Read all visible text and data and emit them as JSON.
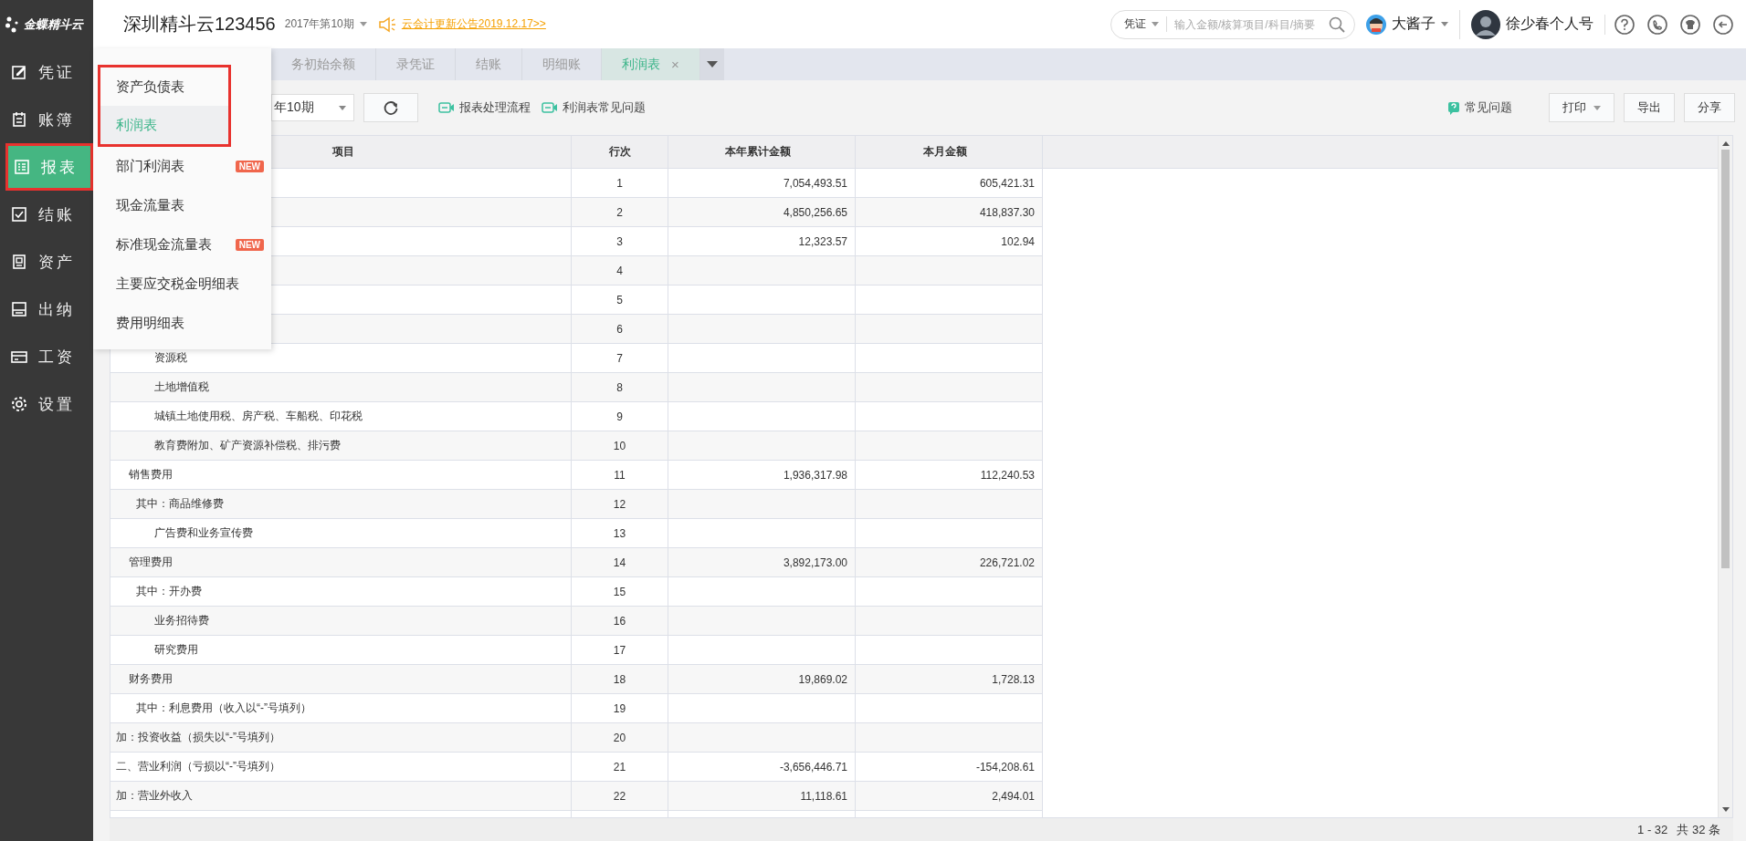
{
  "logo": {
    "text": "金蝶精斗云"
  },
  "header": {
    "company": "深圳精斗云123456",
    "period": "2017年第10期",
    "notice": "云会计更新公告2019.12.17>>",
    "search": {
      "scope": "凭证",
      "placeholder": "输入金额/核算项目/科目/摘要"
    },
    "users": [
      {
        "name": "大酱子",
        "dropdown": true
      },
      {
        "name": "徐少春个人号",
        "dropdown": false
      }
    ]
  },
  "sidebar": {
    "items": [
      {
        "label": "凭证",
        "selected": false,
        "marked": false
      },
      {
        "label": "账簿",
        "selected": false,
        "marked": false
      },
      {
        "label": "报表",
        "selected": true,
        "marked": true
      },
      {
        "label": "结账",
        "selected": false,
        "marked": false
      },
      {
        "label": "资产",
        "selected": false,
        "marked": false
      },
      {
        "label": "出纳",
        "selected": false,
        "marked": false
      },
      {
        "label": "工资",
        "selected": false,
        "marked": false
      },
      {
        "label": "设置",
        "selected": false,
        "marked": false
      }
    ]
  },
  "menu": {
    "items": [
      {
        "label": "资产负债表",
        "selected": false,
        "marked": true
      },
      {
        "label": "利润表",
        "selected": true,
        "marked": true
      },
      {
        "label": "部门利润表",
        "selected": false,
        "marked": false,
        "badge": "NEW"
      },
      {
        "label": "现金流量表",
        "selected": false,
        "marked": false
      },
      {
        "label": "标准现金流量表",
        "selected": false,
        "marked": false,
        "badge": "NEW"
      },
      {
        "label": "主要应交税金明细表",
        "selected": false,
        "marked": false
      },
      {
        "label": "费用明细表",
        "selected": false,
        "marked": false
      }
    ]
  },
  "tabs": [
    {
      "label": "务初始余额",
      "selected": false
    },
    {
      "label": "录凭证",
      "selected": false
    },
    {
      "label": "结账",
      "selected": false
    },
    {
      "label": "明细账",
      "selected": false
    },
    {
      "label": "利润表",
      "selected": true,
      "close": "×"
    }
  ],
  "toolbar": {
    "period": "年10期",
    "links": [
      "报表处理流程",
      "利润表常见问题"
    ],
    "help": "常见问题",
    "buttons": [
      {
        "label": "打印",
        "dropdown": true
      },
      {
        "label": "导出",
        "dropdown": false
      },
      {
        "label": "分享",
        "dropdown": false
      }
    ]
  },
  "table": {
    "columns": [
      "项目",
      "行次",
      "本年累计金额",
      "本月金额"
    ],
    "rows": [
      {
        "line": "1",
        "ytd": "7,054,493.51",
        "month": "605,421.31"
      },
      {
        "line": "2",
        "ytd": "4,850,256.65",
        "month": "418,837.30"
      },
      {
        "line": "3",
        "ytd": "12,323.57",
        "month": "102.94"
      },
      {
        "line": "4"
      },
      {
        "line": "5"
      },
      {
        "line": "6"
      },
      {
        "item": "资源税",
        "kind": "detail",
        "line": "7"
      },
      {
        "item": "土地增值税",
        "kind": "detail",
        "line": "8"
      },
      {
        "item": "城镇土地使用税、房产税、车船税、印花税",
        "kind": "detail",
        "line": "9"
      },
      {
        "item": "教育费附加、矿产资源补偿税、排污费",
        "kind": "detail",
        "line": "10"
      },
      {
        "item": "销售费用",
        "kind": "item",
        "line": "11",
        "ytd": "1,936,317.98",
        "month": "112,240.53"
      },
      {
        "item": "其中：商品维修费",
        "kind": "sub",
        "line": "12"
      },
      {
        "item": "广告费和业务宣传费",
        "kind": "detail",
        "line": "13"
      },
      {
        "item": "管理费用",
        "kind": "item",
        "line": "14",
        "ytd": "3,892,173.00",
        "month": "226,721.02"
      },
      {
        "item": "其中：开办费",
        "kind": "sub",
        "line": "15"
      },
      {
        "item": "业务招待费",
        "kind": "detail",
        "line": "16"
      },
      {
        "item": "研究费用",
        "kind": "detail",
        "line": "17"
      },
      {
        "item": "财务费用",
        "kind": "item",
        "line": "18",
        "ytd": "19,869.02",
        "month": "1,728.13"
      },
      {
        "item": "其中：利息费用（收入以“-”号填列）",
        "kind": "sub",
        "line": "19"
      },
      {
        "item": "加：投资收益（损失以“-”号填列）",
        "kind": "top",
        "line": "20"
      },
      {
        "item": "二、营业利润（亏损以“-”号填列）",
        "kind": "top",
        "line": "21",
        "ytd": "-3,656,446.71",
        "month": "-154,208.61"
      },
      {
        "item": "加：营业外收入",
        "kind": "top",
        "line": "22",
        "ytd": "11,118.61",
        "month": "2,494.01"
      }
    ]
  },
  "pager": {
    "range": "1 - 32",
    "total": "共 32 条"
  }
}
